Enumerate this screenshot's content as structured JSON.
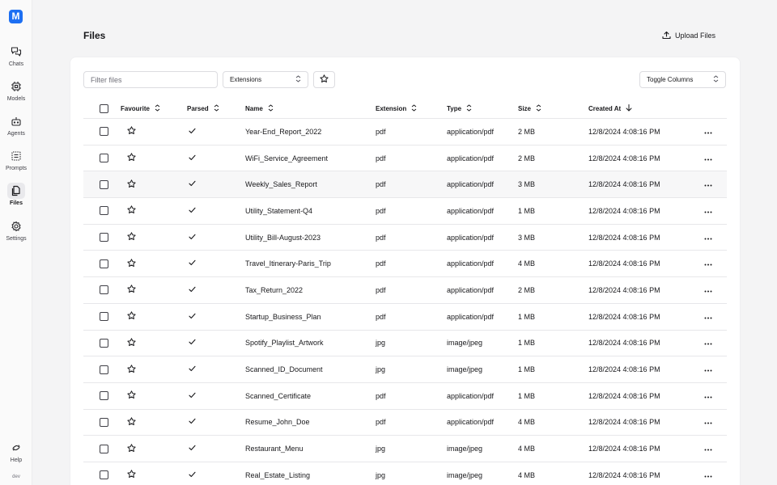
{
  "app": {
    "logo_letter": "M",
    "env": "dev"
  },
  "sidebar": {
    "items": [
      {
        "label": "Chats",
        "icon": "chat-icon"
      },
      {
        "label": "Models",
        "icon": "chip-icon"
      },
      {
        "label": "Agents",
        "icon": "bot-icon"
      },
      {
        "label": "Prompts",
        "icon": "prompt-icon"
      },
      {
        "label": "Files",
        "icon": "files-icon",
        "active": true
      },
      {
        "label": "Settings",
        "icon": "gear-icon"
      }
    ],
    "help_label": "Help"
  },
  "header": {
    "title": "Files",
    "upload_label": "Upload Files"
  },
  "toolbar": {
    "filter_placeholder": "Filter files",
    "extensions_label": "Extensions",
    "toggle_columns_label": "Toggle Columns"
  },
  "table": {
    "columns": {
      "favourite": "Favourite",
      "parsed": "Parsed",
      "name": "Name",
      "extension": "Extension",
      "type": "Type",
      "size": "Size",
      "created_at": "Created At"
    },
    "rows": [
      {
        "name": "Year-End_Report_2022",
        "extension": "pdf",
        "type": "application/pdf",
        "size": "2 MB",
        "created_at": "12/8/2024 4:08:16 PM"
      },
      {
        "name": "WiFi_Service_Agreement",
        "extension": "pdf",
        "type": "application/pdf",
        "size": "2 MB",
        "created_at": "12/8/2024 4:08:16 PM"
      },
      {
        "name": "Weekly_Sales_Report",
        "extension": "pdf",
        "type": "application/pdf",
        "size": "3 MB",
        "created_at": "12/8/2024 4:08:16 PM"
      },
      {
        "name": "Utility_Statement-Q4",
        "extension": "pdf",
        "type": "application/pdf",
        "size": "1 MB",
        "created_at": "12/8/2024 4:08:16 PM"
      },
      {
        "name": "Utility_Bill-August-2023",
        "extension": "pdf",
        "type": "application/pdf",
        "size": "3 MB",
        "created_at": "12/8/2024 4:08:16 PM"
      },
      {
        "name": "Travel_Itinerary-Paris_Trip",
        "extension": "pdf",
        "type": "application/pdf",
        "size": "4 MB",
        "created_at": "12/8/2024 4:08:16 PM"
      },
      {
        "name": "Tax_Return_2022",
        "extension": "pdf",
        "type": "application/pdf",
        "size": "2 MB",
        "created_at": "12/8/2024 4:08:16 PM"
      },
      {
        "name": "Startup_Business_Plan",
        "extension": "pdf",
        "type": "application/pdf",
        "size": "1 MB",
        "created_at": "12/8/2024 4:08:16 PM"
      },
      {
        "name": "Spotify_Playlist_Artwork",
        "extension": "jpg",
        "type": "image/jpeg",
        "size": "1 MB",
        "created_at": "12/8/2024 4:08:16 PM"
      },
      {
        "name": "Scanned_ID_Document",
        "extension": "jpg",
        "type": "image/jpeg",
        "size": "1 MB",
        "created_at": "12/8/2024 4:08:16 PM"
      },
      {
        "name": "Scanned_Certificate",
        "extension": "pdf",
        "type": "application/pdf",
        "size": "1 MB",
        "created_at": "12/8/2024 4:08:16 PM"
      },
      {
        "name": "Resume_John_Doe",
        "extension": "pdf",
        "type": "application/pdf",
        "size": "4 MB",
        "created_at": "12/8/2024 4:08:16 PM"
      },
      {
        "name": "Restaurant_Menu",
        "extension": "jpg",
        "type": "image/jpeg",
        "size": "4 MB",
        "created_at": "12/8/2024 4:08:16 PM"
      },
      {
        "name": "Real_Estate_Listing",
        "extension": "jpg",
        "type": "image/jpeg",
        "size": "4 MB",
        "created_at": "12/8/2024 4:08:16 PM"
      }
    ]
  },
  "colors": {
    "brand": "#1d6ff2",
    "background": "#f4f4f5",
    "card": "#ffffff",
    "border": "#e7e7ea"
  }
}
